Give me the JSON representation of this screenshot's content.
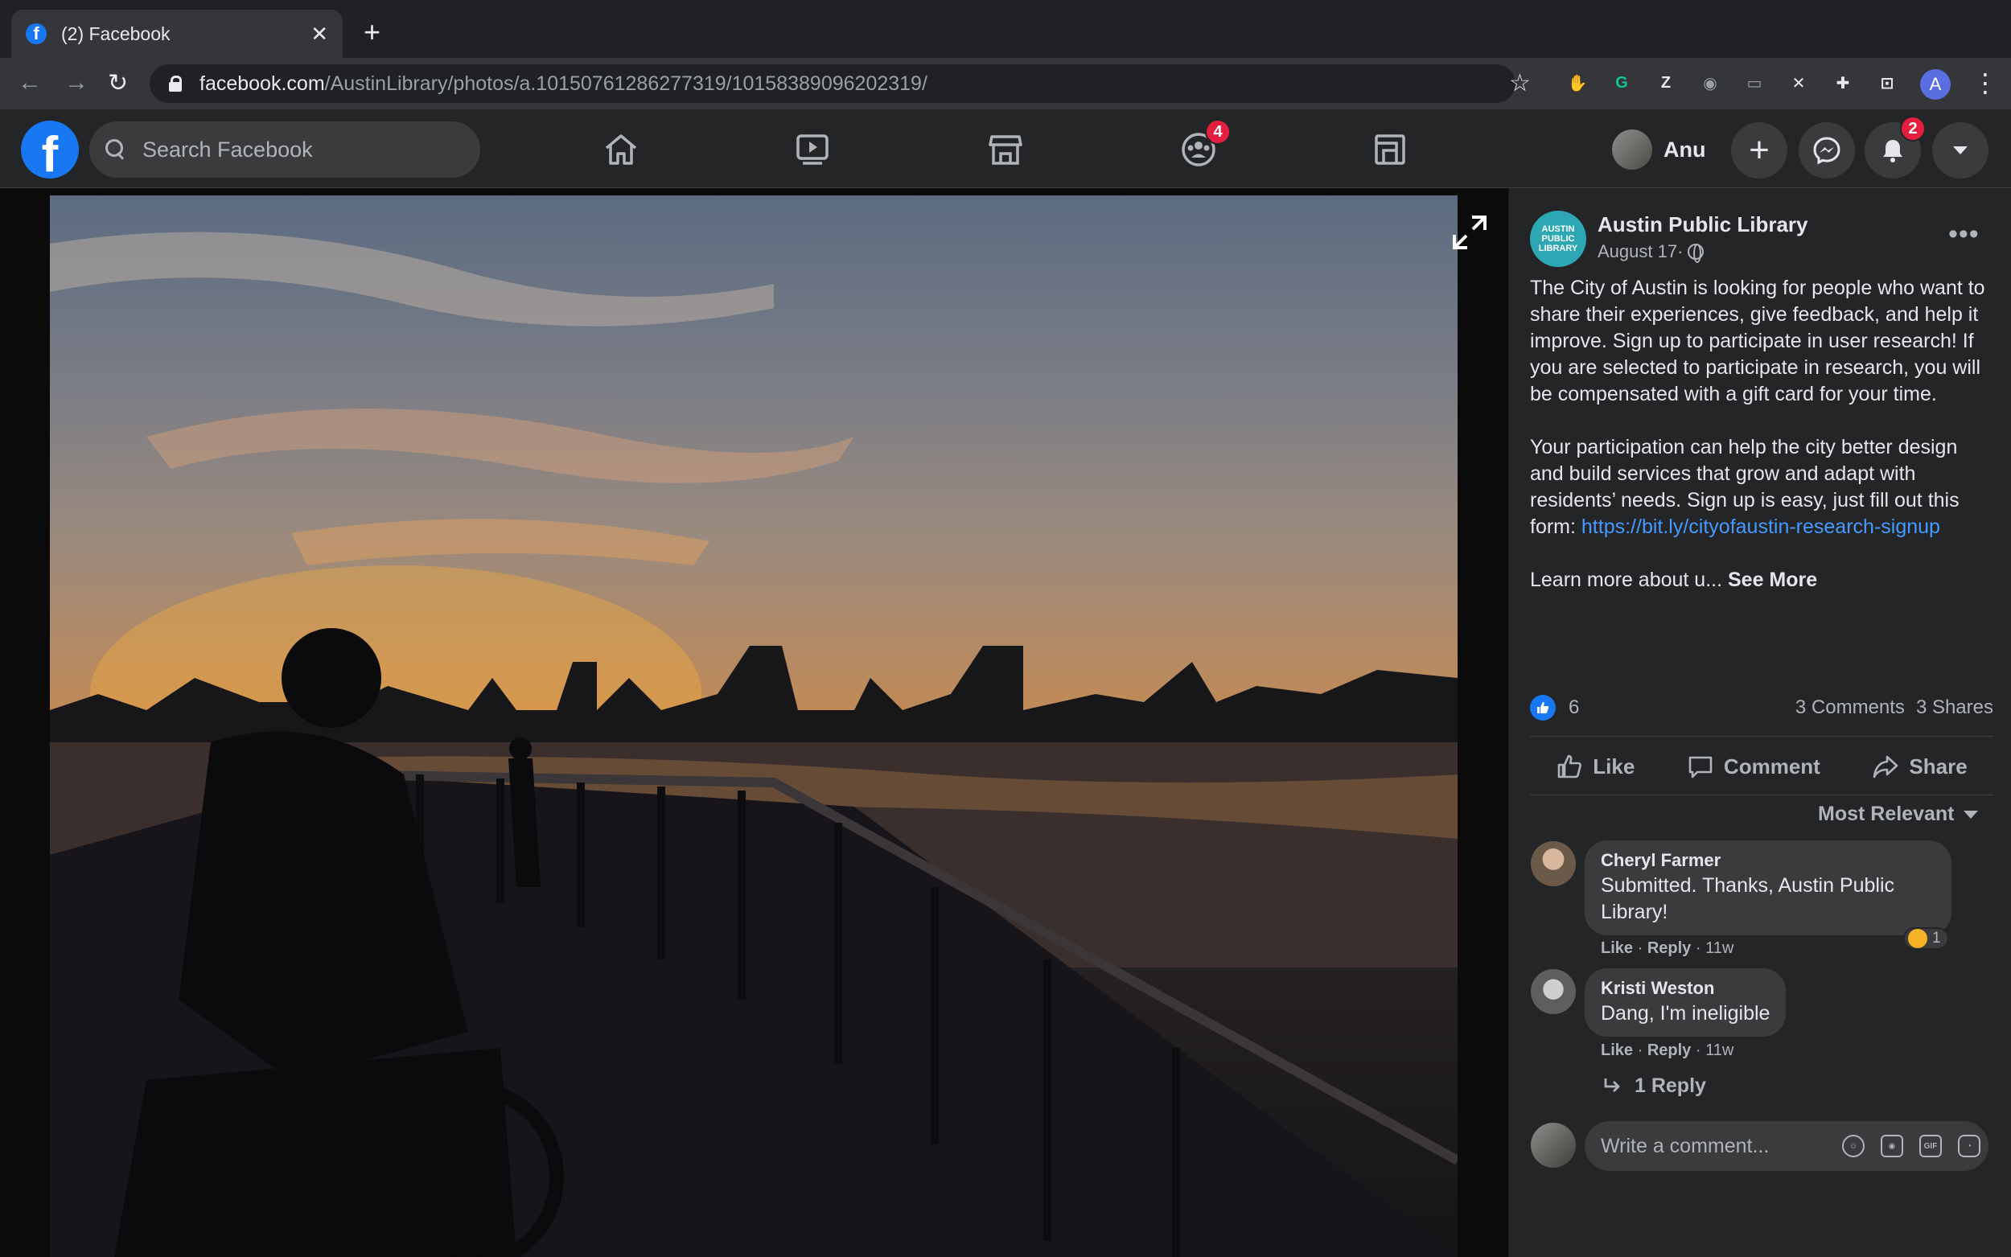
{
  "browser": {
    "tab_title": "(2) Facebook",
    "tab_close": "✕",
    "new_tab": "+",
    "url_domain": "facebook.com",
    "url_path": "/AustinLibrary/photos/a.10150761286277319/10158389096202319/",
    "back_icon": "←",
    "forward_icon": "→",
    "reload_icon": "↻",
    "bookmark_icon": "☆",
    "profile_initial": "A",
    "menu_icon": "⋮",
    "extensions": [
      {
        "icon": "stop-extension-icon",
        "glyph": "✋",
        "color": "#e8453c"
      },
      {
        "icon": "grammarly-icon",
        "glyph": "G",
        "color": "#15c39a"
      },
      {
        "icon": "zotero-icon",
        "glyph": "Z",
        "color": "#e8eaed"
      },
      {
        "icon": "camera-icon",
        "glyph": "◉",
        "color": "#9aa0a6"
      },
      {
        "icon": "screen-icon",
        "glyph": "▭",
        "color": "#9aa0a6"
      },
      {
        "icon": "x-tool-icon",
        "glyph": "✕",
        "color": "#e8eaed"
      },
      {
        "icon": "puzzle-icon",
        "glyph": "✚",
        "color": "#e8eaed"
      },
      {
        "icon": "cast-icon",
        "glyph": "⊡",
        "color": "#e8eaed"
      }
    ]
  },
  "header": {
    "logo_letter": "f",
    "search_placeholder": "Search Facebook",
    "groups_badge": "4",
    "notifications_badge": "2",
    "user_name": "Anu",
    "create_icon": "+",
    "colors": {
      "accent": "#1877f2",
      "badge": "#e41e3f"
    }
  },
  "post": {
    "page_avatar_text": "AUSTIN PUBLIC LIBRARY",
    "page_name": "Austin Public Library",
    "date": "August 17",
    "date_sep": " · ",
    "more_icon": "•••",
    "paragraph1": "The City of Austin is looking for people who want to share their experiences, give feedback, and help it improve. Sign up to participate in user research! If you are selected to participate in research, you will be compensated with a gift card for your time.",
    "paragraph2_text": "Your participation can help the city better design and build services that grow and adapt with residents’ needs. Sign up is easy, just fill out this form: ",
    "paragraph2_link": "https://bit.ly/cityofaustin-research-signup",
    "paragraph3_text": "Learn more about u... ",
    "see_more": "See More",
    "likes": "6",
    "comments_count": "3 Comments",
    "shares_count": "3 Shares",
    "actions": {
      "like": "Like",
      "comment": "Comment",
      "share": "Share"
    },
    "sort_label": "Most Relevant"
  },
  "comments": [
    {
      "author": "Cheryl Farmer",
      "text_line1": "Submitted. Thanks, Austin Public",
      "text_line2": "Library!",
      "like": "Like",
      "reply": "Reply",
      "age": "11w",
      "reaction_count": "1"
    },
    {
      "author": "Kristi Weston",
      "text_line1": "Dang, I'm ineligible",
      "like": "Like",
      "reply": "Reply",
      "age": "11w"
    }
  ],
  "replies_link": "1 Reply",
  "composer": {
    "placeholder": "Write a comment...",
    "gif_label": "GIF"
  }
}
